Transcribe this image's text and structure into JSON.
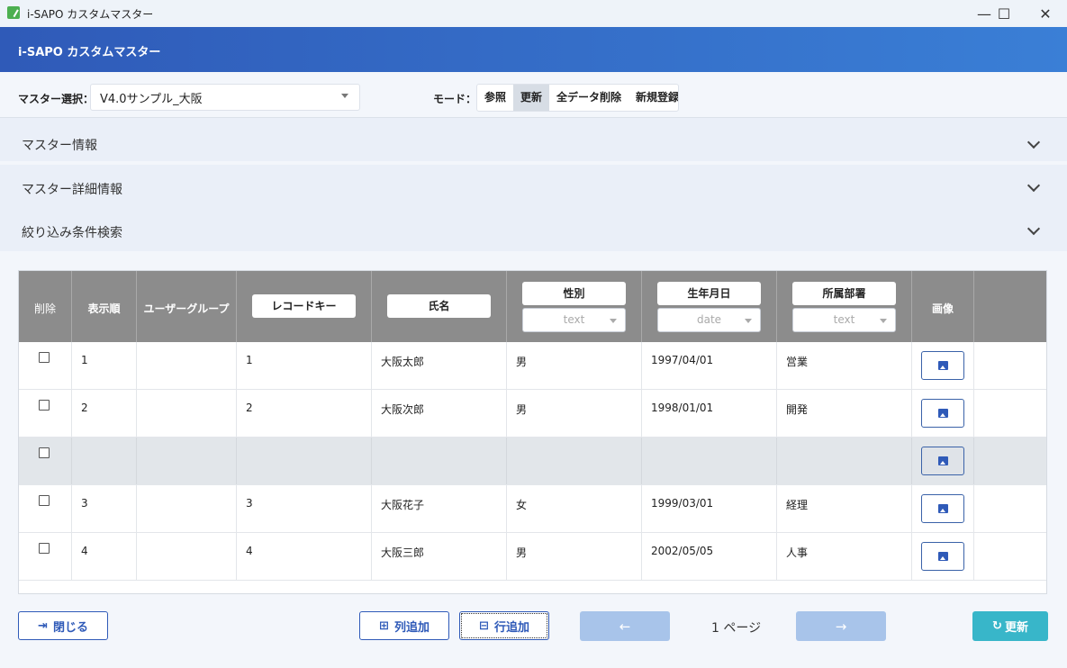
{
  "window": {
    "title": "i-SAPO カスタムマスター",
    "controls": {
      "minimize": "—",
      "maximize": "☐",
      "close": "✕"
    }
  },
  "header": {
    "title": "i-SAPO カスタムマスター"
  },
  "master_select": {
    "label": "マスター選択：",
    "value": "V4.0サンプル_大阪"
  },
  "mode": {
    "label": "モード：",
    "options": [
      "参照",
      "更新",
      "全データ削除",
      "新規登録"
    ],
    "selected": "更新"
  },
  "accordions": [
    "マスター情報",
    "マスター詳細情報",
    "絞り込み条件検索"
  ],
  "table": {
    "columns": {
      "delete": "削除",
      "order": "表示順",
      "user_group": "ユーザーグループ",
      "record_key": "レコードキー",
      "name": "氏名",
      "gender": "性別",
      "gender_filter": "text",
      "birthdate": "生年月日",
      "birthdate_filter": "date",
      "department": "所属部署",
      "department_filter": "text",
      "image": "画像"
    },
    "rows": [
      {
        "order": "1",
        "user_group": "",
        "record_key": "1",
        "name": "大阪太郎",
        "gender": "男",
        "birthdate": "1997/04/01",
        "department": "営業"
      },
      {
        "order": "2",
        "user_group": "",
        "record_key": "2",
        "name": "大阪次郎",
        "gender": "男",
        "birthdate": "1998/01/01",
        "department": "開発"
      },
      {
        "order": "",
        "user_group": "",
        "record_key": "",
        "name": "",
        "gender": "",
        "birthdate": "",
        "department": ""
      },
      {
        "order": "3",
        "user_group": "",
        "record_key": "3",
        "name": "大阪花子",
        "gender": "女",
        "birthdate": "1999/03/01",
        "department": "経理"
      },
      {
        "order": "4",
        "user_group": "",
        "record_key": "4",
        "name": "大阪三郎",
        "gender": "男",
        "birthdate": "2002/05/05",
        "department": "人事"
      }
    ]
  },
  "footer": {
    "close_label": "閉じる",
    "add_column_label": "列追加",
    "add_row_label": "行追加",
    "prev_label": "←",
    "next_label": "→",
    "page_label": "1 ページ",
    "update_label": "更新"
  },
  "colors": {
    "header_start": "#2f5ab8",
    "header_end": "#3a7fd6",
    "table_header": "#8c8c8c",
    "accent": "#2f5ab8",
    "update_button": "#38b6c9",
    "nav_button_disabled": "#a8c4ea"
  }
}
